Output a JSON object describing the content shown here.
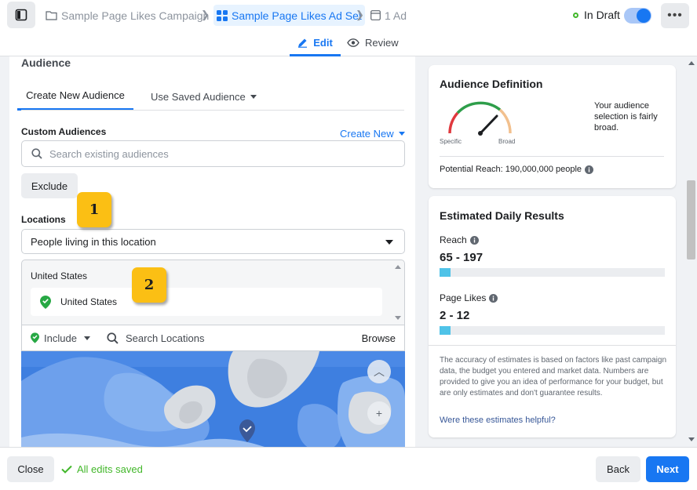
{
  "header": {
    "breadcrumbs": [
      {
        "label": "Sample Page Likes Campaign",
        "icon": "folder-icon"
      },
      {
        "label": "Sample Page Likes Ad Set",
        "icon": "grid-icon"
      },
      {
        "label": "1 Ad",
        "icon": "ad-icon"
      }
    ],
    "status": "In Draft",
    "more_label": "•••"
  },
  "mode_tabs": {
    "edit": "Edit",
    "review": "Review"
  },
  "audience": {
    "section_title": "Audience",
    "tabs": {
      "create_new": "Create New Audience",
      "use_saved": "Use Saved Audience"
    },
    "custom_audiences_label": "Custom Audiences",
    "create_new_label": "Create New",
    "search_placeholder": "Search existing audiences",
    "exclude_label": "Exclude",
    "locations_label": "Locations",
    "location_type": "People living in this location",
    "location_group": "United States",
    "location_selected": "United States",
    "include_label": "Include",
    "search_locations_placeholder": "Search Locations",
    "browse_label": "Browse"
  },
  "callouts": [
    "1",
    "2"
  ],
  "definition_card": {
    "title": "Audience Definition",
    "specific_label": "Specific",
    "broad_label": "Broad",
    "description": "Your audience selection is fairly broad.",
    "potential_reach": "Potential Reach: 190,000,000 people"
  },
  "results_card": {
    "title": "Estimated Daily Results",
    "reach_label": "Reach",
    "reach_value": "65 - 197",
    "reach_fill_pct": 5,
    "likes_label": "Page Likes",
    "likes_value": "2 - 12",
    "likes_fill_pct": 5,
    "disclaimer": "The accuracy of estimates is based on factors like past campaign data, the budget you entered and market data. Numbers are provided to give you an idea of performance for your budget, but are only estimates and don't guarantee results.",
    "helpful_link": "Were these estimates helpful?"
  },
  "footer": {
    "close_label": "Close",
    "saved_label": "All edits saved",
    "back_label": "Back",
    "next_label": "Next"
  },
  "colors": {
    "accent": "#1877f2",
    "success": "#42b72a",
    "callout": "#fbbf14",
    "bar": "#4fc3e8"
  }
}
